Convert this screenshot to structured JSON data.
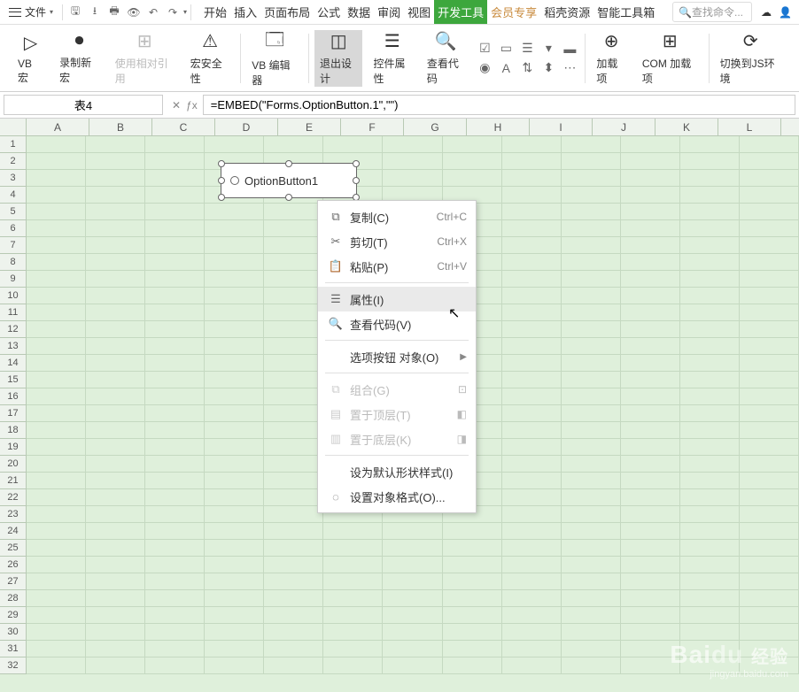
{
  "menubar": {
    "file_label": "文件",
    "tabs": [
      "开始",
      "插入",
      "页面布局",
      "公式",
      "数据",
      "审阅",
      "视图",
      "开发工具",
      "会员专享",
      "稻壳资源",
      "智能工具箱"
    ],
    "active_tab": "开发工具",
    "search_placeholder": "查找命令..."
  },
  "ribbon": {
    "btns": {
      "vb_macro": "VB 宏",
      "record_macro": "录制新宏",
      "use_rel_ref": "使用相对引用",
      "macro_security": "宏安全性",
      "vb_editor": "VB 编辑器",
      "exit_design": "退出设计",
      "control_props": "控件属性",
      "view_code": "查看代码",
      "addins": "加载项",
      "com_addins": "COM 加载项",
      "switch_js": "切换到JS环境"
    }
  },
  "namebox": {
    "value": "表4"
  },
  "formula": {
    "value": "=EMBED(\"Forms.OptionButton.1\",\"\")"
  },
  "columns": [
    "A",
    "B",
    "C",
    "D",
    "E",
    "F",
    "G",
    "H",
    "I",
    "J",
    "K",
    "L"
  ],
  "rows": [
    "1",
    "2",
    "3",
    "4",
    "5",
    "6",
    "7",
    "8",
    "9",
    "10",
    "11",
    "12",
    "13",
    "14",
    "15",
    "16",
    "17",
    "18",
    "19",
    "20",
    "21",
    "22",
    "23",
    "24",
    "25",
    "26",
    "27",
    "28",
    "29",
    "30",
    "31",
    "32"
  ],
  "option_object": {
    "label": "OptionButton1"
  },
  "context_menu": {
    "copy": {
      "label": "复制(C)",
      "shortcut": "Ctrl+C"
    },
    "cut": {
      "label": "剪切(T)",
      "shortcut": "Ctrl+X"
    },
    "paste": {
      "label": "粘贴(P)",
      "shortcut": "Ctrl+V"
    },
    "properties": {
      "label": "属性(I)"
    },
    "view_code": {
      "label": "查看代码(V)"
    },
    "option_obj": {
      "label": "选项按钮 对象(O)"
    },
    "group": {
      "label": "组合(G)"
    },
    "to_front": {
      "label": "置于顶层(T)"
    },
    "to_back": {
      "label": "置于底层(K)"
    },
    "default_style": {
      "label": "设为默认形状样式(I)"
    },
    "format_obj": {
      "label": "设置对象格式(O)..."
    }
  },
  "watermark": {
    "logo": "Bai",
    "du": "du",
    "suf": "经验",
    "url": "jingyan.baidu.com"
  }
}
